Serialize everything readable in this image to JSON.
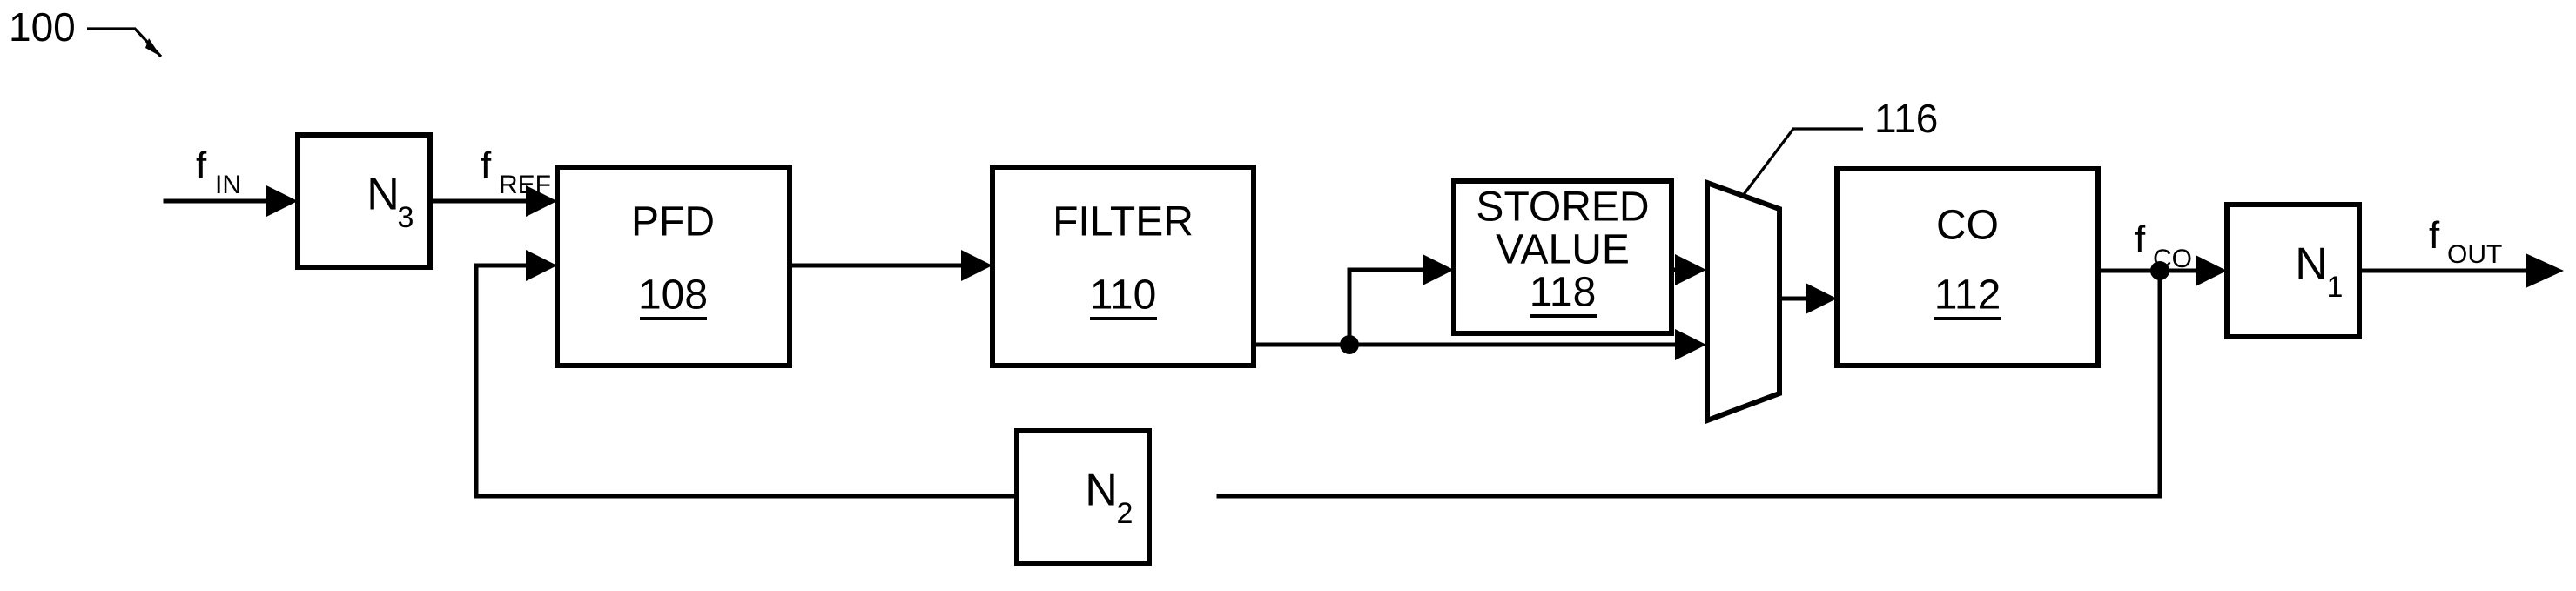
{
  "figure": {
    "reference_numeral": "100",
    "description": "Phase locked loop block diagram"
  },
  "blocks": [
    {
      "id": "n3",
      "label": "N",
      "subscript": "3",
      "ref": ""
    },
    {
      "id": "pfd",
      "label": "PFD",
      "subscript": "",
      "ref": "108"
    },
    {
      "id": "filter",
      "label": "FILTER",
      "subscript": "",
      "ref": "110"
    },
    {
      "id": "stored",
      "label_line1": "STORED",
      "label_line2": "VALUE",
      "ref": "118"
    },
    {
      "id": "mux",
      "label": "",
      "ref": "116"
    },
    {
      "id": "co",
      "label": "CO",
      "subscript": "",
      "ref": "112"
    },
    {
      "id": "n1",
      "label": "N",
      "subscript": "1",
      "ref": ""
    },
    {
      "id": "n2",
      "label": "N",
      "subscript": "2",
      "ref": ""
    }
  ],
  "block_labels": {
    "n3_main": "N",
    "n3_sub": "3",
    "pfd_main": "PFD",
    "pfd_ref": "108",
    "filter_main": "FILTER",
    "filter_ref": "110",
    "stored_line1": "STORED",
    "stored_line2": "VALUE",
    "stored_ref": "118",
    "mux_ref": "116",
    "co_main": "CO",
    "co_ref": "112",
    "n1_main": "N",
    "n1_sub": "1",
    "n2_main": "N",
    "n2_sub": "2"
  },
  "signals": {
    "f_in_main": "f",
    "f_in_sub": "IN",
    "f_ref_main": "f",
    "f_ref_sub": "REF",
    "f_co_main": "f",
    "f_co_sub": "CO",
    "f_out_main": "f",
    "f_out_sub": "OUT"
  },
  "colors": {
    "line": "#000000",
    "background": "#ffffff",
    "fill": "#ffffff"
  }
}
